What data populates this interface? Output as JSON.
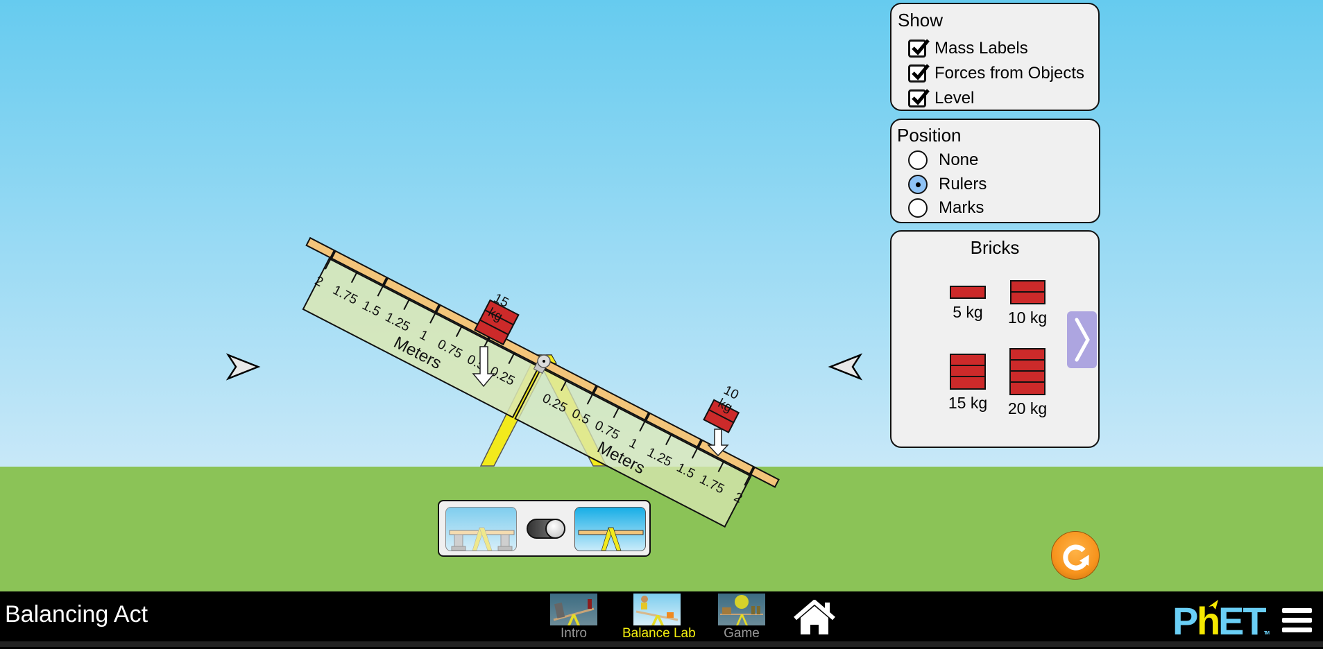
{
  "app": {
    "title": "Balancing Act"
  },
  "show_panel": {
    "title": "Show",
    "options": [
      {
        "label": "Mass Labels",
        "checked": true
      },
      {
        "label": "Forces from Objects",
        "checked": true
      },
      {
        "label": "Level",
        "checked": true
      }
    ]
  },
  "position_panel": {
    "title": "Position",
    "options": [
      {
        "label": "None",
        "selected": false
      },
      {
        "label": "Rulers",
        "selected": true
      },
      {
        "label": "Marks",
        "selected": false
      }
    ]
  },
  "bricks_panel": {
    "title": "Bricks",
    "items": [
      {
        "label": "5 kg",
        "bricks": 1
      },
      {
        "label": "10 kg",
        "bricks": 2
      },
      {
        "label": "15 kg",
        "bricks": 3
      },
      {
        "label": "20 kg",
        "bricks": 4
      }
    ],
    "next_icon": "chevron-right-icon"
  },
  "plank": {
    "ruler_label": "Meters",
    "left_ticks": [
      "2",
      "1.75",
      "1.5",
      "1.25",
      "1",
      "0.75",
      "0.5",
      "0.25"
    ],
    "right_ticks": [
      "0.25",
      "0.5",
      "0.75",
      "1",
      "1.25",
      "1.5",
      "1.75",
      "2"
    ],
    "left_mass": {
      "value": "15",
      "unit": "kg",
      "position_m": 0.5,
      "bricks": 3
    },
    "right_mass": {
      "value": "10",
      "unit": "kg",
      "position_m": 1.5,
      "bricks": 2
    }
  },
  "supports_toggle": {
    "state": "off",
    "left_icon": "supports-on-icon",
    "right_icon": "supports-off-icon"
  },
  "level_indicators": {
    "left": "level-arrow-right-icon",
    "right": "level-arrow-left-icon"
  },
  "reset": {
    "icon": "reset-icon"
  },
  "navbar": {
    "tabs": [
      {
        "label": "Intro",
        "active": false
      },
      {
        "label": "Balance Lab",
        "active": true
      },
      {
        "label": "Game",
        "active": false
      }
    ],
    "home_icon": "home-icon",
    "logo_text": "PhET",
    "menu_icon": "hamburger-menu-icon"
  },
  "colors": {
    "sky_top": "#66cbef",
    "ground": "#8bc357",
    "plank": "#f3c57a",
    "brick": "#cc2a2a",
    "ruler": "#dbe8b4",
    "fulcrum": "#f2ea1c",
    "reset": "#f7941d",
    "active_tab": "#f5f00f"
  }
}
